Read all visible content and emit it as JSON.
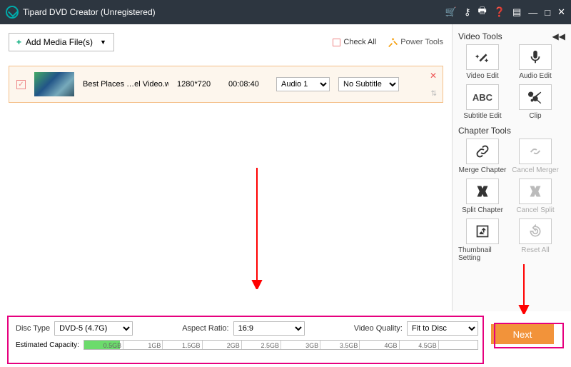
{
  "title": "Tipard DVD Creator (Unregistered)",
  "toolbar": {
    "add_media": "Add Media File(s)",
    "check_all": "Check All",
    "power_tools": "Power Tools"
  },
  "item": {
    "name": "Best Places …el Video.wmv",
    "resolution": "1280*720",
    "duration": "00:08:40",
    "audio": "Audio 1",
    "subtitle": "No Subtitle"
  },
  "video_tools": {
    "title": "Video Tools",
    "items": [
      "Video Edit",
      "Audio Edit",
      "Subtitle Edit",
      "Clip"
    ]
  },
  "chapter_tools": {
    "title": "Chapter Tools",
    "items": [
      "Merge Chapter",
      "Cancel Merger",
      "Split Chapter",
      "Cancel Split",
      "Thumbnail Setting",
      "Reset All"
    ]
  },
  "bottom": {
    "disc_type_label": "Disc Type",
    "disc_type": "DVD-5 (4.7G)",
    "aspect_label": "Aspect Ratio:",
    "aspect": "16:9",
    "quality_label": "Video Quality:",
    "quality": "Fit to Disc",
    "capacity_label": "Estimated Capacity:",
    "ticks": [
      "0.5GB",
      "1GB",
      "1.5GB",
      "2GB",
      "2.5GB",
      "3GB",
      "3.5GB",
      "4GB",
      "4.5GB",
      ""
    ]
  },
  "next": "Next"
}
